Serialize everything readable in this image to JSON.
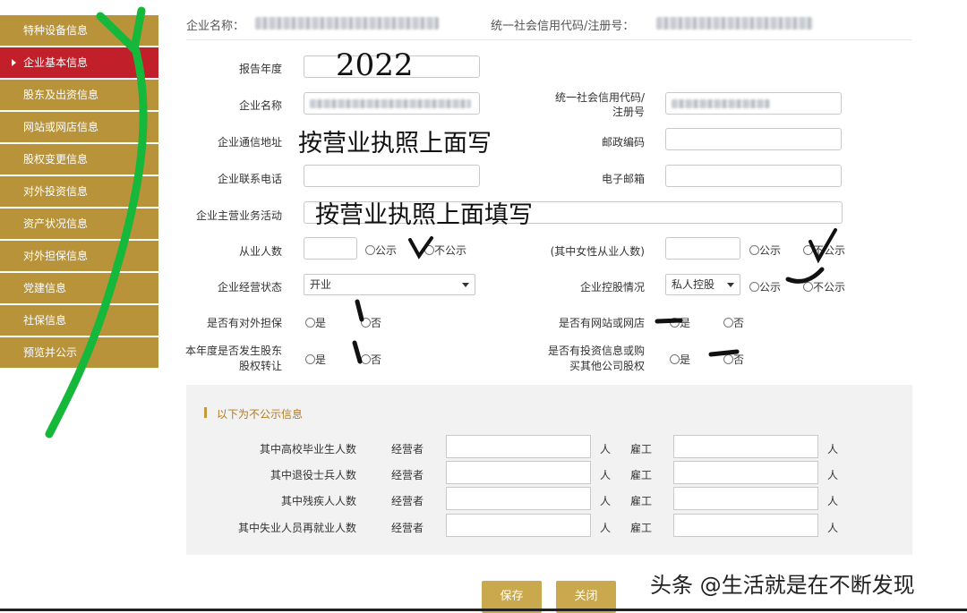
{
  "sidebar": {
    "items": [
      {
        "label": "特种设备信息"
      },
      {
        "label": "企业基本信息"
      },
      {
        "label": "股东及出资信息"
      },
      {
        "label": "网站或网店信息"
      },
      {
        "label": "股权变更信息"
      },
      {
        "label": "对外投资信息"
      },
      {
        "label": "资产状况信息"
      },
      {
        "label": "对外担保信息"
      },
      {
        "label": "党建信息"
      },
      {
        "label": "社保信息"
      },
      {
        "label": "预览并公示"
      }
    ],
    "active_index": 1
  },
  "header": {
    "company_name_label": "企业名称：",
    "credit_code_label": "统一社会信用代码/注册号："
  },
  "form": {
    "report_year_label": "报告年度",
    "company_name_label": "企业名称",
    "credit_code_label_1": "统一社会信用代码/",
    "credit_code_label_2": "注册号",
    "address_label": "企业通信地址",
    "postal_label": "邮政编码",
    "phone_label": "企业联系电话",
    "email_label": "电子邮箱",
    "business_label": "企业主营业务活动",
    "employees_label": "从业人数",
    "female_label": "(其中女性从业人数)",
    "public_label": "公示",
    "not_public_label": "不公示",
    "status_label": "企业经营状态",
    "status_value": "开业",
    "holding_label": "企业控股情况",
    "holding_value": "私人控股",
    "guarantee_label": "是否有对外担保",
    "website_label": "是否有网站或网店",
    "yes_label": "是",
    "no_label": "否",
    "transfer_label_1": "本年度是否发生股东",
    "transfer_label_2": "股权转让",
    "invest_label_1": "是否有投资信息或购",
    "invest_label_2": "买其他公司股权"
  },
  "handwriting": {
    "year": "2022",
    "address_note": "按营业执照上面写",
    "business_note": "按营业执照上面填写"
  },
  "private_section": {
    "title": "以下为不公示信息",
    "operator_label": "经营者",
    "employee_label": "雇工",
    "unit": "人",
    "rows": [
      {
        "label": "其中高校毕业生人数"
      },
      {
        "label": "其中退役士兵人数"
      },
      {
        "label": "其中残疾人人数"
      },
      {
        "label": "其中失业人员再就业人数"
      }
    ]
  },
  "buttons": {
    "save": "保存",
    "close": "关闭"
  },
  "watermark": "头条 @生活就是在不断发现",
  "colors": {
    "sidebar_bg": "#b8933a",
    "sidebar_active": "#c1202a",
    "button_bg": "#caa84e",
    "section_accent": "#c59a3a"
  }
}
